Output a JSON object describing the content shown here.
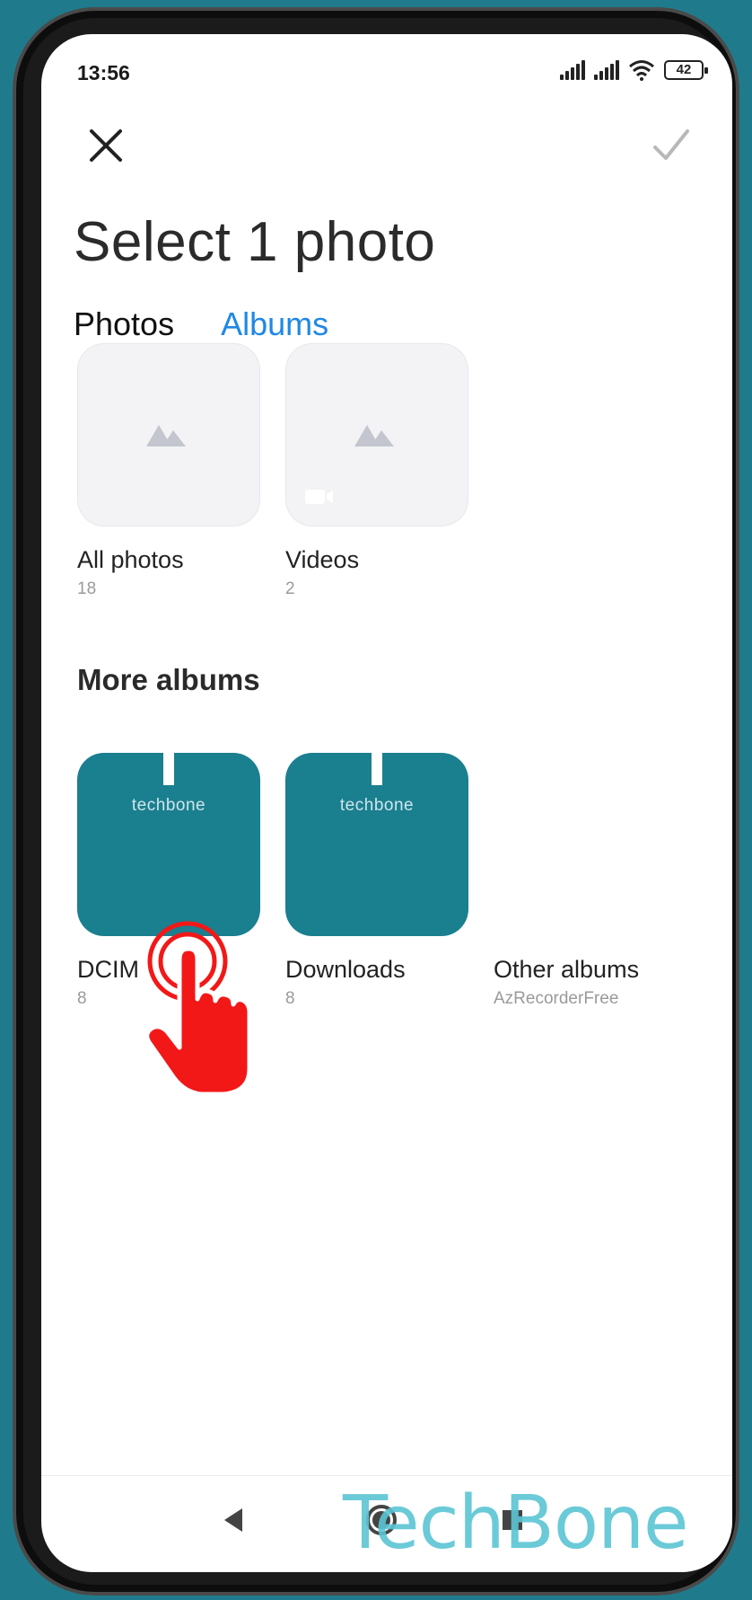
{
  "status_bar": {
    "time": "13:56",
    "battery": "42"
  },
  "header": {
    "title": "Select 1 photo"
  },
  "tabs": [
    {
      "label": "Photos",
      "active": false
    },
    {
      "label": "Albums",
      "active": true
    }
  ],
  "albums": [
    {
      "name": "All photos",
      "count": "18"
    },
    {
      "name": "Videos",
      "count": "2"
    }
  ],
  "more_albums": {
    "heading": "More albums",
    "items": [
      {
        "name": "DCIM",
        "count": "8",
        "thumb_text": "techbone"
      },
      {
        "name": "Downloads",
        "count": "8",
        "thumb_text": "techbone"
      },
      {
        "name": "Other albums",
        "count": "AzRecorderFree"
      }
    ]
  },
  "watermark": "TechBone",
  "colors": {
    "accent": "#1e88e5",
    "album_thumb": "#1a7f8f",
    "background": "#1f7b8c",
    "tap_hand": "#f21818"
  }
}
